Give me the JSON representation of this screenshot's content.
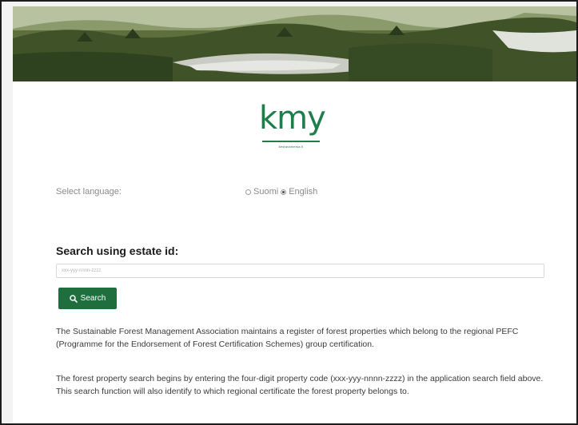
{
  "logo": {
    "text": "kmy",
    "subtext": "kestavametsa.fi"
  },
  "language": {
    "label": "Select language:",
    "options": [
      {
        "label": "Suomi",
        "selected": false
      },
      {
        "label": "English",
        "selected": true
      }
    ]
  },
  "search": {
    "heading": "Search using estate id:",
    "placeholder": "xxx-yyy-nnnn-zzzz",
    "button_label": "Search",
    "button_color": "#1e6e3e"
  },
  "content": {
    "paragraph1": "The Sustainable Forest Management Association maintains a register of forest properties which belong to the regional PEFC (Programme for the Endorsement of Forest Certification Schemes) group certification.",
    "paragraph2": "The forest property search begins by entering the four-digit property code (xxx-yyy-nnnn-zzzz) in the application search field above. This search function will also identify to which regional certificate the forest property belongs to."
  },
  "colors": {
    "brand": "#1f7d4a"
  }
}
